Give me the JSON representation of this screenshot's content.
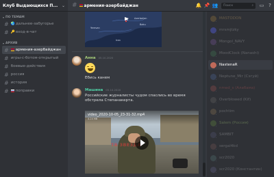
{
  "server": {
    "name": "Клуб Выдающихся П..."
  },
  "categories": {
    "themes": "ПО ТЕМАМ",
    "archive": "АРХИВ"
  },
  "channels_themes": [
    {
      "label": "дальнее-забугорье",
      "emoji": "🌏"
    },
    {
      "label": "вход-в-чат",
      "emoji": "🔑"
    }
  ],
  "channels_archive": [
    {
      "label": "армения-азербайджан",
      "active": true
    },
    {
      "label": "игры-с-ботом-открытый"
    },
    {
      "label": "боевые-действия"
    },
    {
      "label": "россия"
    },
    {
      "label": "история"
    },
    {
      "label": "поправки"
    }
  ],
  "topbar": {
    "channel": "армения-азербайджан",
    "search_placeholder": "Поиск"
  },
  "map": {
    "labels": [
      "Azerbaijan",
      "Baku",
      "Iran",
      "Yerevan"
    ]
  },
  "messages": [
    {
      "author": "Анна",
      "author_color": "#a8cf7a",
      "time": "05.10.2020",
      "emoji": "😆",
      "text": "Ебись канем"
    },
    {
      "author": "Машина",
      "author_color": "#4fd1a5",
      "time": "05.10.2020",
      "text": "Российские журналисты чудом спаслись во время обстрела Степанакерта."
    }
  ],
  "video": {
    "filename": "video_2020-10-05_23-31-32.mp4",
    "size": "4.24 MB",
    "watermark": "ТВ  ЗВЕЗДА"
  },
  "members": [
    {
      "name": "MASTODON",
      "color": "#c9a46b",
      "avatar": "#8a6d3b",
      "dim": true
    },
    {
      "name": "mrsmjtzky",
      "color": "#b9bbbe",
      "avatar": "#5865f2",
      "dim": true
    },
    {
      "name": "Mongol_NAVY",
      "color": "#b9bbbe",
      "avatar": "#6b4f8a",
      "dim": true
    },
    {
      "name": "MoodClock (Nanashi)",
      "color": "#b9bbbe",
      "avatar": "#3f6f4f",
      "dim": true
    },
    {
      "name": "NastenaR",
      "color": "#ffffff",
      "avatar": "#c06a5a",
      "dim": false,
      "active": true
    },
    {
      "name": "Neptune_Mir (Сэгуй)",
      "color": "#b9bbbe",
      "avatar": "#4a5f8a",
      "dim": true
    },
    {
      "name": "nmed_s (Алабама)",
      "color": "#c05a5a",
      "avatar": "#8a4a4a",
      "dim": true
    },
    {
      "name": "Overblowed (Kif)",
      "color": "#b9bbbe",
      "avatar": "#5c5c5c",
      "dim": true
    },
    {
      "name": "pochtim",
      "color": "#b9bbbe",
      "avatar": "#7a6a4f",
      "dim": true
    },
    {
      "name": "Salem (Россия)",
      "color": "#a8cf7a",
      "avatar": "#5a7a3f",
      "dim": true
    },
    {
      "name": "SAMBIT",
      "color": "#b9bbbe",
      "avatar": "#4f4f6a",
      "dim": true
    },
    {
      "name": "sergal4kd",
      "color": "#b9bbbe",
      "avatar": "#6a4f4f",
      "dim": true
    },
    {
      "name": "scr2020",
      "color": "#b9bbbe",
      "avatar": "#4f6a6a",
      "dim": true
    },
    {
      "name": "scr2020 (Константин)",
      "color": "#b9bbbe",
      "avatar": "#5a5a7a",
      "dim": true
    }
  ]
}
